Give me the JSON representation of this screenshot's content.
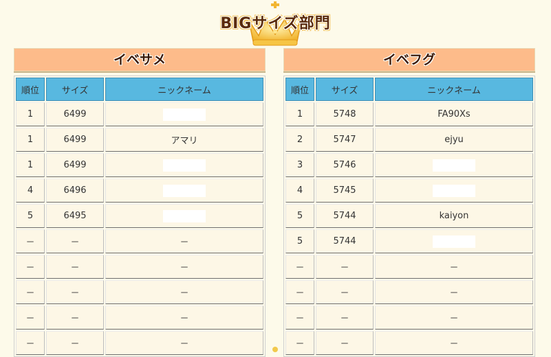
{
  "page": {
    "title": "BIGサイズ部門"
  },
  "columns": {
    "rank": "順位",
    "size": "サイズ",
    "nickname": "ニックネーム"
  },
  "left": {
    "title": "イベサメ",
    "rows": [
      {
        "rank": "1",
        "size": "6499",
        "nickname": ""
      },
      {
        "rank": "1",
        "size": "6499",
        "nickname": "アマリ"
      },
      {
        "rank": "1",
        "size": "6499",
        "nickname": ""
      },
      {
        "rank": "4",
        "size": "6496",
        "nickname": ""
      },
      {
        "rank": "5",
        "size": "6495",
        "nickname": ""
      },
      {
        "rank": "－",
        "size": "－",
        "nickname": "－"
      },
      {
        "rank": "－",
        "size": "－",
        "nickname": "－"
      },
      {
        "rank": "－",
        "size": "－",
        "nickname": "－"
      },
      {
        "rank": "－",
        "size": "－",
        "nickname": "－"
      },
      {
        "rank": "－",
        "size": "－",
        "nickname": "－"
      }
    ]
  },
  "right": {
    "title": "イベフグ",
    "rows": [
      {
        "rank": "1",
        "size": "5748",
        "nickname": "FA90Xs"
      },
      {
        "rank": "2",
        "size": "5747",
        "nickname": "ejyu"
      },
      {
        "rank": "3",
        "size": "5746",
        "nickname": ""
      },
      {
        "rank": "4",
        "size": "5745",
        "nickname": ""
      },
      {
        "rank": "5",
        "size": "5744",
        "nickname": "kaiyon"
      },
      {
        "rank": "5",
        "size": "5744",
        "nickname": ""
      },
      {
        "rank": "－",
        "size": "－",
        "nickname": "－"
      },
      {
        "rank": "－",
        "size": "－",
        "nickname": "－"
      },
      {
        "rank": "－",
        "size": "－",
        "nickname": "－"
      },
      {
        "rank": "－",
        "size": "－",
        "nickname": "－"
      }
    ]
  },
  "colors": {
    "background": "#fdfaea",
    "panel_header": "#fdbb8a",
    "table_header": "#58b8e0"
  },
  "icons": {
    "crown": "crown-icon"
  }
}
